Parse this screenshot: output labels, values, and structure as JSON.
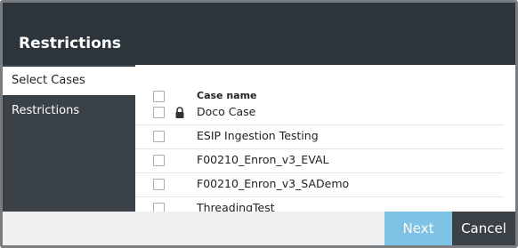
{
  "dialog": {
    "title": "Restrictions"
  },
  "sidebar": {
    "items": [
      {
        "label": "Select Cases",
        "active": true
      },
      {
        "label": "Restrictions",
        "active": false
      }
    ]
  },
  "table": {
    "header": {
      "name_label": "Case name"
    },
    "rows": [
      {
        "name": "Doco Case",
        "locked": true,
        "icon": "lock-icon"
      },
      {
        "name": "ESIP Ingestion Testing",
        "locked": false
      },
      {
        "name": "F00210_Enron_v3_EVAL",
        "locked": false
      },
      {
        "name": "F00210_Enron_v3_SADemo",
        "locked": false
      },
      {
        "name": "ThreadingTest",
        "locked": false
      }
    ]
  },
  "footer": {
    "next_label": "Next",
    "cancel_label": "Cancel"
  },
  "colors": {
    "header_bg": "#2c353b",
    "sidebar_bg": "#3a4147",
    "next_button_bg": "#7ec3e6",
    "cancel_button_bg": "#3a4147"
  }
}
